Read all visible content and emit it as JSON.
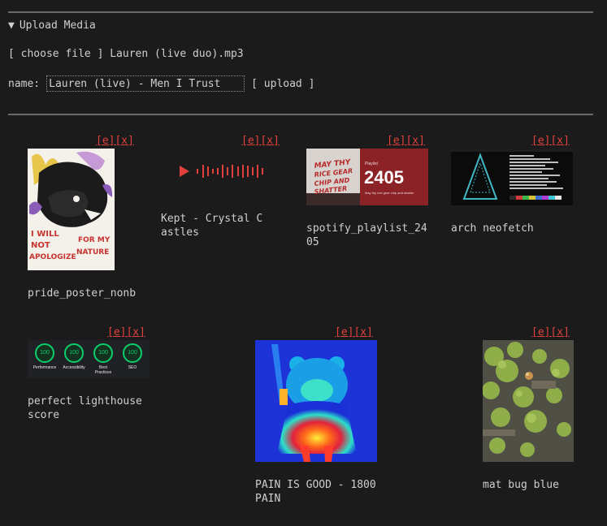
{
  "upload": {
    "summary": "Upload Media",
    "choose_label": "[ choose file ]",
    "file_name": "Lauren (live duo).mp3",
    "name_label": "name:",
    "name_value": "Lauren (live) - Men I Trust",
    "upload_label": "[ upload ]"
  },
  "actions": {
    "edit": "[e]",
    "delete": "[x]"
  },
  "items": [
    {
      "caption": "pride_poster_nonb",
      "kind": "image",
      "poster_text_left": "I WILL NOT APOLOGIZE",
      "poster_text_right": "FOR MY NATURE"
    },
    {
      "caption": "Kept - Crystal Castles",
      "kind": "audio"
    },
    {
      "caption": "spotify_playlist_2405",
      "kind": "image",
      "playlist_kind": "Playlist",
      "playlist_number": "2405",
      "playlist_subtitle": "May thy rice gear chip and shatter",
      "sign_text": "MAY THY RICE GEAR CHIP AND SHATTER"
    },
    {
      "caption": "arch neofetch",
      "kind": "image"
    },
    {
      "caption": "perfect lighthouse score",
      "kind": "image",
      "scores": [
        {
          "value": "100",
          "label": "Performance"
        },
        {
          "value": "100",
          "label": "Accessibility"
        },
        {
          "value": "100",
          "label": "Best Practices"
        },
        {
          "value": "100",
          "label": "SEO"
        }
      ]
    },
    {
      "caption": "PAIN IS GOOD - 1800 PAIN",
      "kind": "image"
    },
    {
      "caption": "mat bug blue",
      "kind": "image"
    }
  ],
  "colors": {
    "background": "#1b1b1b",
    "text": "#cfcfcf",
    "accent": "#e0413d",
    "rule": "#6a6a6a",
    "lighthouse_green": "#0cce6b"
  }
}
